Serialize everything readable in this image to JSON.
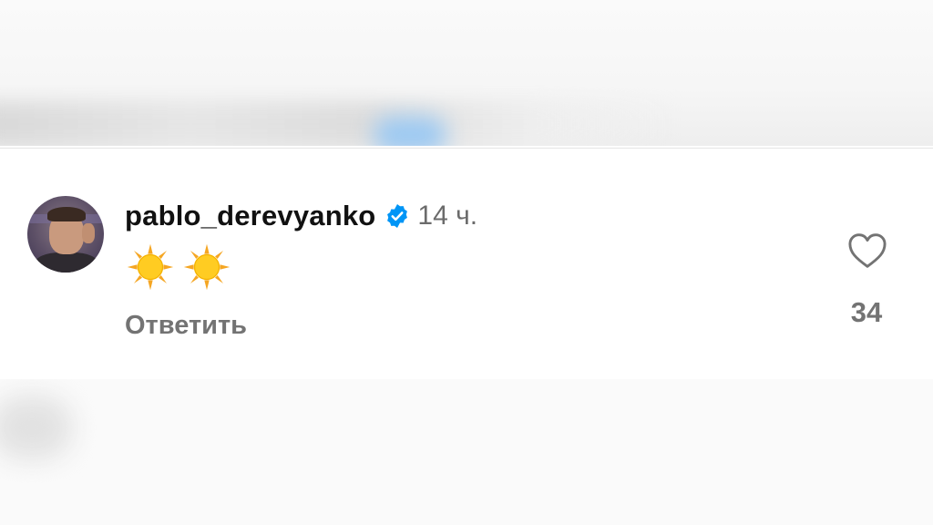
{
  "comment": {
    "username": "pablo_derevyanko",
    "verified": true,
    "time": "14 ч.",
    "body_emojis": [
      "sun-icon",
      "sun-icon"
    ],
    "reply_label": "Ответить",
    "likes": "34"
  },
  "colors": {
    "verified_badge": "#0095f6",
    "username": "#111111",
    "secondary_text": "#737373",
    "sun": "#ffcc22"
  }
}
